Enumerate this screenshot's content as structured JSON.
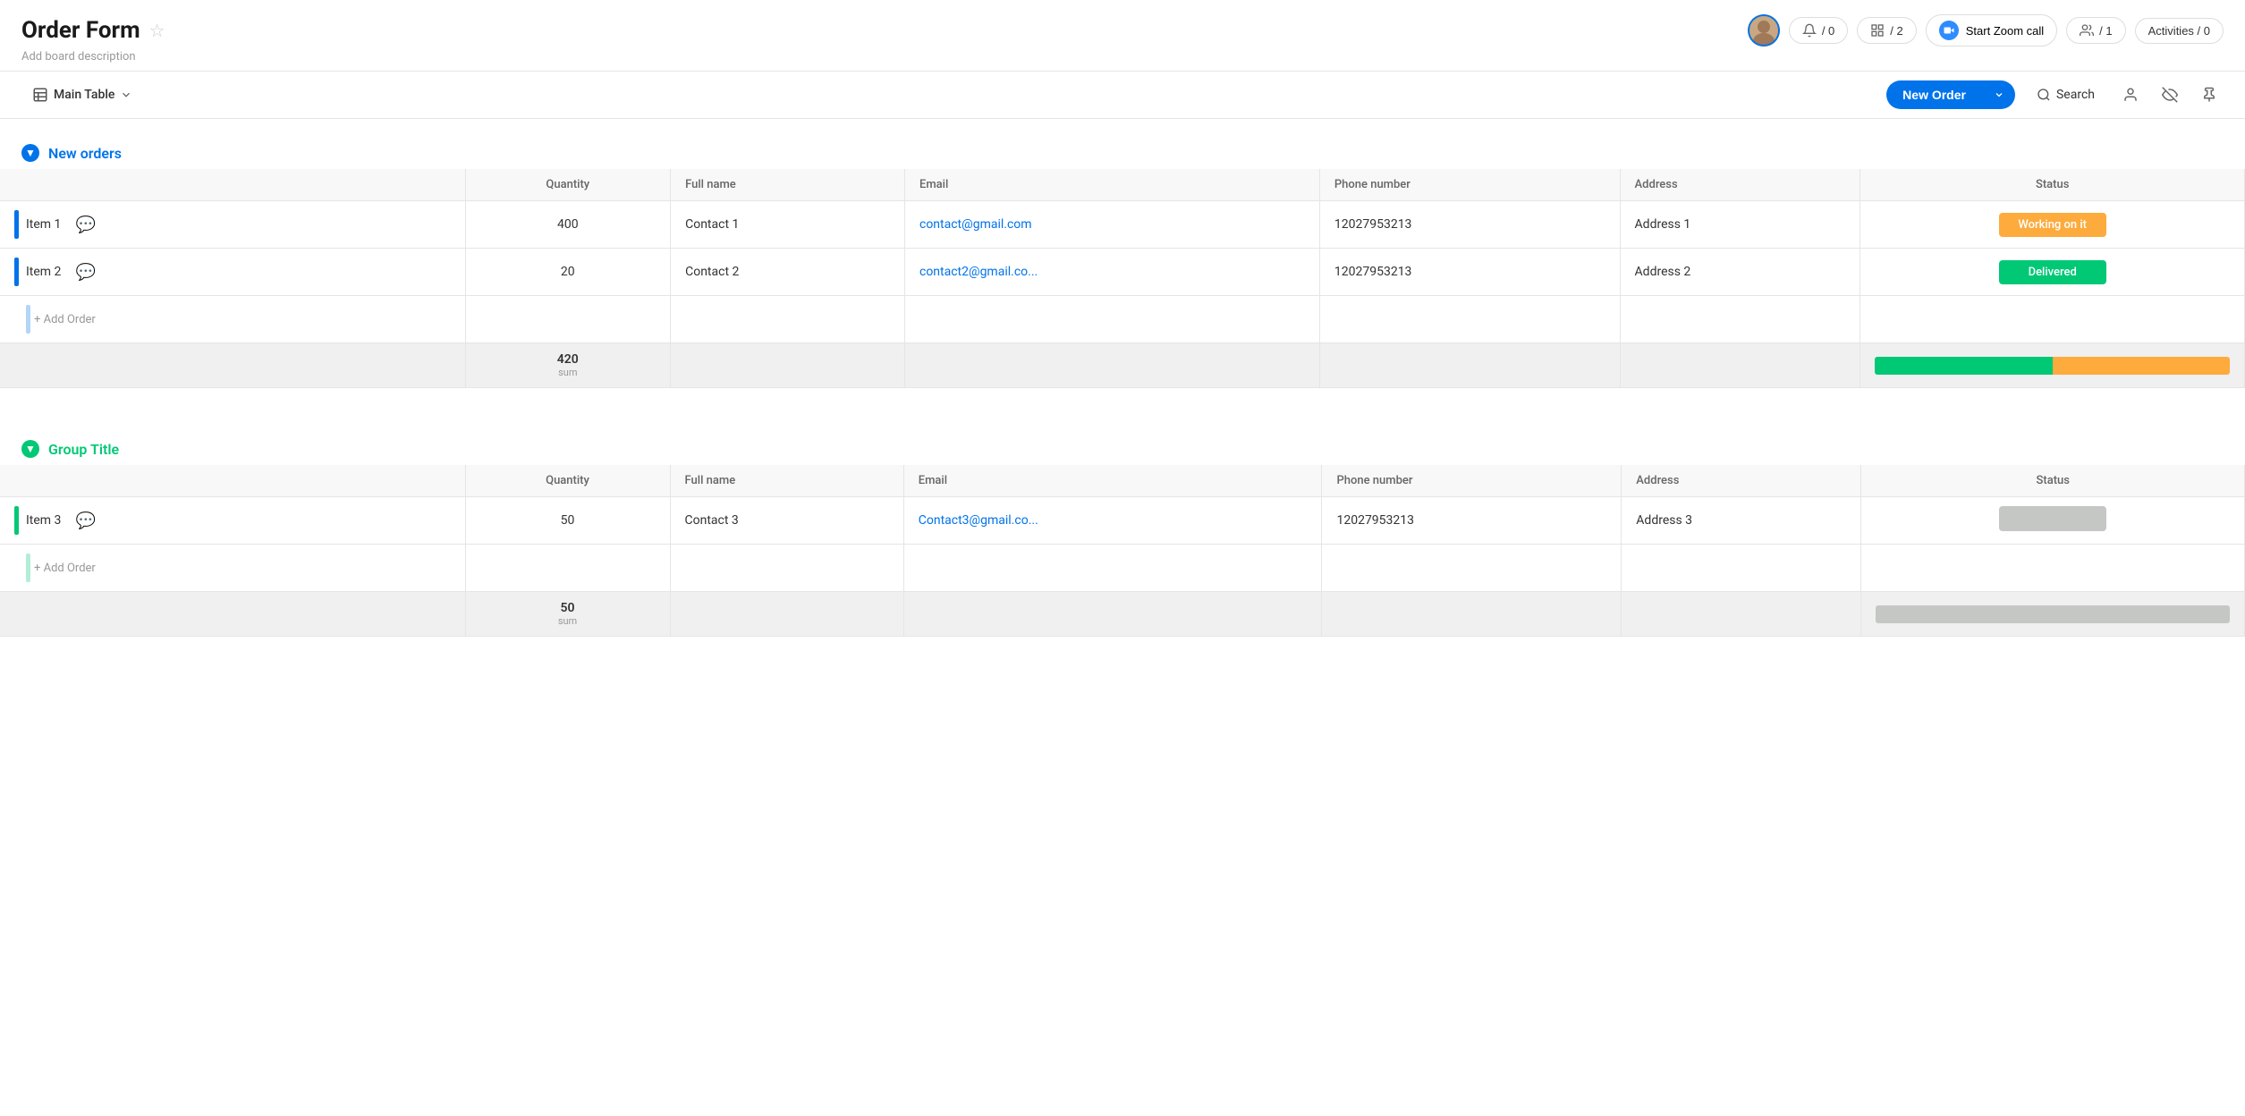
{
  "header": {
    "title": "Order Form",
    "description": "Add board description",
    "star_label": "☆",
    "zoom_label": "Start Zoom call",
    "notifications_count": "/ 0",
    "integrations_count": "/ 2",
    "members_count": "/ 1",
    "activities_label": "Activities / 0"
  },
  "toolbar": {
    "main_table_label": "Main Table",
    "new_order_label": "New Order",
    "search_label": "Search"
  },
  "groups": [
    {
      "id": "new-orders",
      "title": "New orders",
      "color": "blue",
      "columns": [
        "Quantity",
        "Full name",
        "Email",
        "Phone number",
        "Address",
        "Status"
      ],
      "rows": [
        {
          "name": "Item 1",
          "quantity": "400",
          "full_name": "Contact 1",
          "email": "contact@gmail.com",
          "phone": "12027953213",
          "address": "Address 1",
          "status": "Working on it",
          "status_type": "working"
        },
        {
          "name": "Item 2",
          "quantity": "20",
          "full_name": "Contact 2",
          "email": "contact2@gmail.co...",
          "phone": "12027953213",
          "address": "Address 2",
          "status": "Delivered",
          "status_type": "delivered"
        }
      ],
      "add_label": "+ Add Order",
      "sum_value": "420",
      "sum_label": "sum"
    },
    {
      "id": "group-title",
      "title": "Group Title",
      "color": "green",
      "columns": [
        "Quantity",
        "Full name",
        "Email",
        "Phone number",
        "Address",
        "Status"
      ],
      "rows": [
        {
          "name": "Item 3",
          "quantity": "50",
          "full_name": "Contact 3",
          "email": "Contact3@gmail.co...",
          "phone": "12027953213",
          "address": "Address 3",
          "status": "",
          "status_type": "empty"
        }
      ],
      "add_label": "+ Add Order",
      "sum_value": "50",
      "sum_label": "sum"
    }
  ]
}
